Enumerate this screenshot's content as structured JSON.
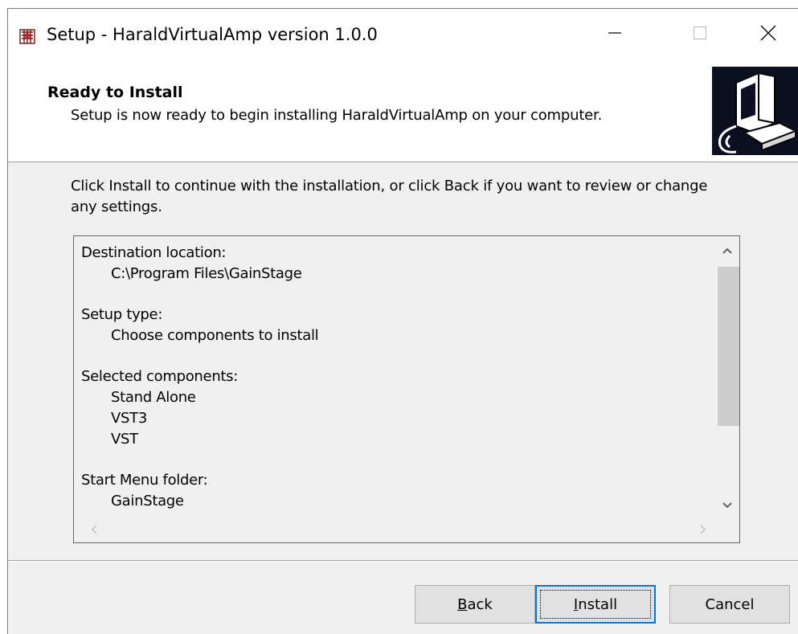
{
  "window": {
    "title": "Setup - HaraldVirtualAmp version 1.0.0",
    "icon": "installer-app-icon",
    "controls": {
      "minimize": "minimize-icon",
      "maximize": "maximize-icon",
      "close": "close-icon"
    }
  },
  "header": {
    "title": "Ready to Install",
    "subtitle": "Setup is now ready to begin installing HaraldVirtualAmp on your computer.",
    "image": "computer-install-icon"
  },
  "instruction": "Click Install to continue with the installation, or click Back if you want to review or change any settings.",
  "summary": {
    "sections": [
      {
        "heading": "Destination location:",
        "items": [
          "C:\\Program Files\\GainStage"
        ]
      },
      {
        "heading": "Setup type:",
        "items": [
          "Choose components to install"
        ]
      },
      {
        "heading": "Selected components:",
        "items": [
          "Stand Alone",
          "VST3",
          "VST"
        ]
      },
      {
        "heading": "Start Menu folder:",
        "items": [
          "GainStage"
        ]
      }
    ]
  },
  "buttons": {
    "back_pre": "",
    "back_key": "B",
    "back_post": "ack",
    "install_pre": "",
    "install_key": "I",
    "install_post": "nstall",
    "cancel": "Cancel"
  },
  "colors": {
    "focus": "#0078d7",
    "dialog_bg": "#f0f0f0",
    "header_bg": "#ffffff",
    "wizard_image_bg": "#0d1020"
  }
}
